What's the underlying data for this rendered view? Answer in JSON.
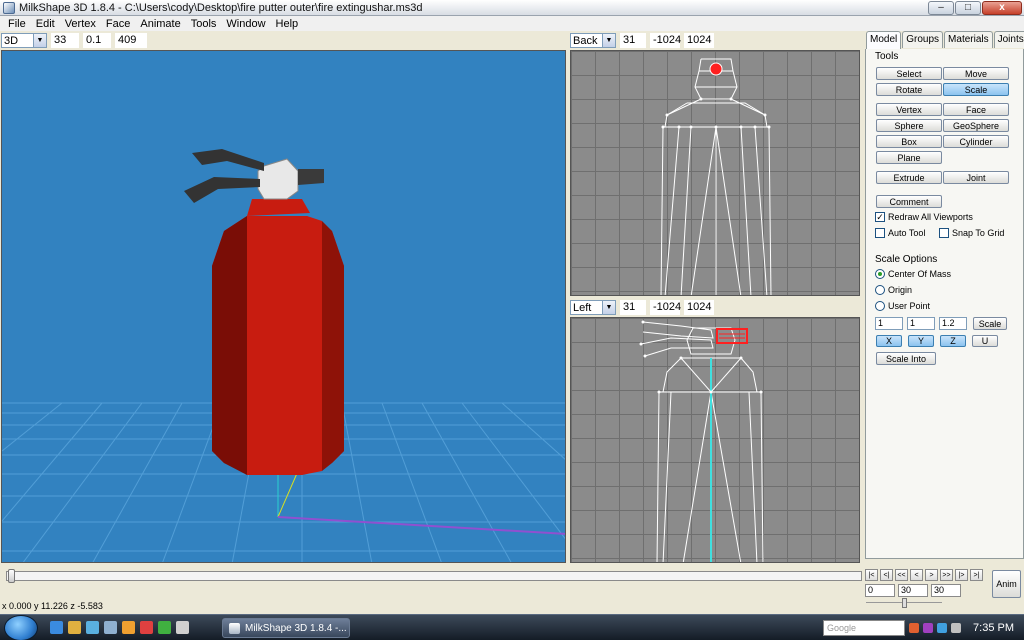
{
  "window": {
    "title": "MilkShape 3D 1.8.4 - C:\\Users\\cody\\Desktop\\fire putter outer\\fire extingushar.ms3d",
    "minimize": "–",
    "maximize": "□",
    "close": "x"
  },
  "menu": [
    "File",
    "Edit",
    "Vertex",
    "Face",
    "Animate",
    "Tools",
    "Window",
    "Help"
  ],
  "viewport_3d": {
    "mode": "3D",
    "fields": [
      "33",
      "0.1",
      "409"
    ]
  },
  "viewport_back": {
    "mode": "Back",
    "fields": [
      "31",
      "-1024",
      "1024"
    ]
  },
  "viewport_left": {
    "mode": "Left",
    "fields": [
      "31",
      "-1024",
      "1024"
    ]
  },
  "panel": {
    "tabs": [
      "Model",
      "Groups",
      "Materials",
      "Joints"
    ],
    "active_tab": "Model",
    "tools_title": "Tools",
    "tools": {
      "select": "Select",
      "move": "Move",
      "rotate": "Rotate",
      "scale": "Scale",
      "vertex": "Vertex",
      "face": "Face",
      "sphere": "Sphere",
      "geosphere": "GeoSphere",
      "box": "Box",
      "cylinder": "Cylinder",
      "plane": "Plane",
      "extrude": "Extrude",
      "joint": "Joint",
      "comment": "Comment"
    },
    "active_tool": "Scale",
    "options": {
      "redraw": "Redraw All Viewports",
      "redraw_checked": true,
      "autotool": "Auto Tool",
      "autotool_checked": false,
      "snap": "Snap To Grid",
      "snap_checked": false
    },
    "scale_options": {
      "title": "Scale Options",
      "center_of_mass": "Center Of Mass",
      "origin": "Origin",
      "user_point": "User Point",
      "selected": "Center Of Mass",
      "x_value": "1",
      "y_value": "1",
      "z_value": "1.2",
      "scale_button": "Scale",
      "axis_x": "X",
      "axis_y": "Y",
      "axis_z": "Z",
      "axis_u": "U",
      "scale_into": "Scale Into"
    }
  },
  "timeline": {
    "start_frame": "0",
    "frame_a": "30",
    "frame_b": "30",
    "anim_button": "Anim",
    "controls": [
      "|<",
      "<|",
      "<<",
      "<",
      ">",
      ">>",
      "|>",
      ">|"
    ]
  },
  "status": "x 0.000 y 11.226 z -5.583",
  "taskbar": {
    "task_label": "MilkShape 3D 1.8.4 -...",
    "search_placeholder": "Google",
    "clock": "7:35 PM"
  },
  "colors": {
    "viewport_3d_bg": "#3282c0",
    "ortho_bg": "#8c8c8c",
    "extinguisher_red": "#c2180e",
    "selection_red": "#ff2020"
  }
}
